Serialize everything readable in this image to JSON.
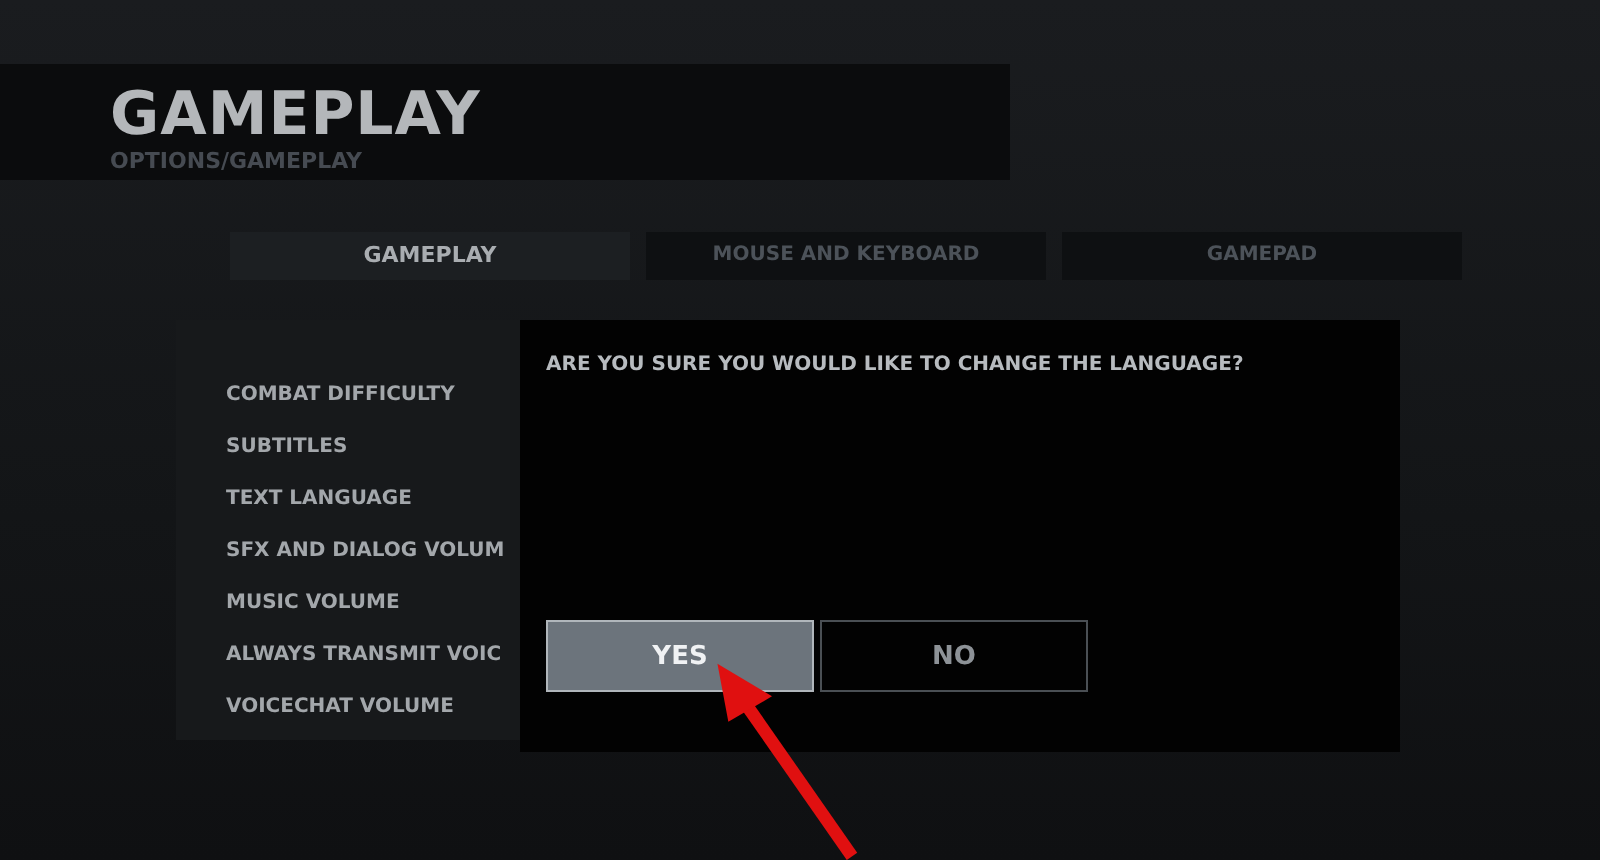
{
  "header": {
    "title": "GAMEPLAY",
    "breadcrumb": "OPTIONS/GAMEPLAY"
  },
  "tabs": [
    {
      "label": "GAMEPLAY",
      "selected": true
    },
    {
      "label": "MOUSE AND KEYBOARD",
      "selected": false
    },
    {
      "label": "GAMEPAD",
      "selected": false
    }
  ],
  "settings": [
    "COMBAT DIFFICULTY",
    "SUBTITLES",
    "TEXT LANGUAGE",
    "SFX AND DIALOG VOLUM",
    "MUSIC VOLUME",
    "ALWAYS TRANSMIT VOIC",
    "VOICECHAT VOLUME"
  ],
  "dialog": {
    "message": "ARE YOU SURE YOU WOULD LIKE TO CHANGE THE LANGUAGE?",
    "buttons": [
      {
        "label": "YES",
        "selected": true
      },
      {
        "label": "NO",
        "selected": false
      }
    ]
  }
}
